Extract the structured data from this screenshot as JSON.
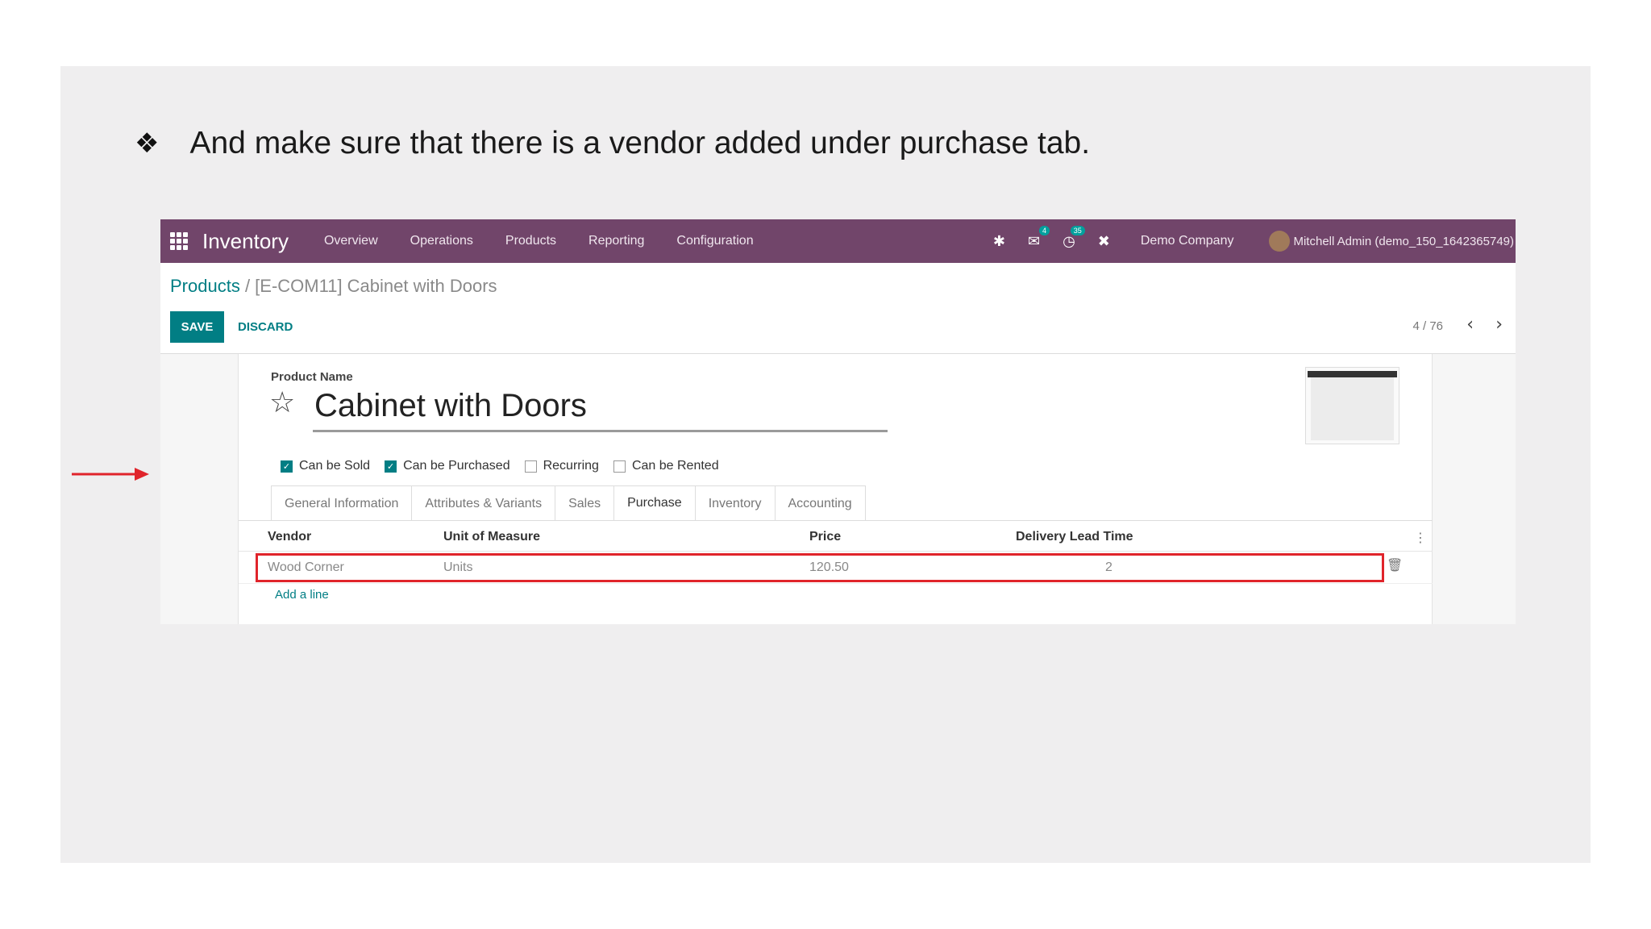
{
  "slide": {
    "bullet": "❖",
    "instruction": "And make sure that there is a vendor added under purchase tab."
  },
  "navbar": {
    "app_title": "Inventory",
    "menu": [
      "Overview",
      "Operations",
      "Products",
      "Reporting",
      "Configuration"
    ],
    "chat_badge": "4",
    "activity_badge": "35",
    "company": "Demo Company",
    "user": "Mitchell Admin (demo_150_1642365749)",
    "icons": [
      "apps-grid-icon",
      "bug-icon",
      "chat-icon",
      "clock-icon",
      "tools-icon"
    ]
  },
  "breadcrumb": {
    "parent": "Products",
    "separator": " / ",
    "current": "[E-COM11] Cabinet with Doors"
  },
  "controls": {
    "save": "SAVE",
    "discard": "DISCARD",
    "pager": "4 / 76"
  },
  "form": {
    "product_name_label": "Product Name",
    "product_name": "Cabinet with Doors",
    "checkboxes": [
      {
        "label": "Can be Sold",
        "checked": true
      },
      {
        "label": "Can be Purchased",
        "checked": true
      },
      {
        "label": "Recurring",
        "checked": false
      },
      {
        "label": "Can be Rented",
        "checked": false
      }
    ],
    "tabs": [
      "General Information",
      "Attributes & Variants",
      "Sales",
      "Purchase",
      "Inventory",
      "Accounting"
    ],
    "active_tab": "Purchase"
  },
  "vendor_table": {
    "headers": {
      "vendor": "Vendor",
      "uom": "Unit of Measure",
      "price": "Price",
      "lead_time": "Delivery Lead Time"
    },
    "rows": [
      {
        "vendor": "Wood Corner",
        "uom": "Units",
        "price": "120.50",
        "lead_time": "2"
      }
    ],
    "add_line": "Add a line"
  },
  "colors": {
    "navbar": "#71456a",
    "primary": "#017e84",
    "highlight": "#e0242b"
  }
}
